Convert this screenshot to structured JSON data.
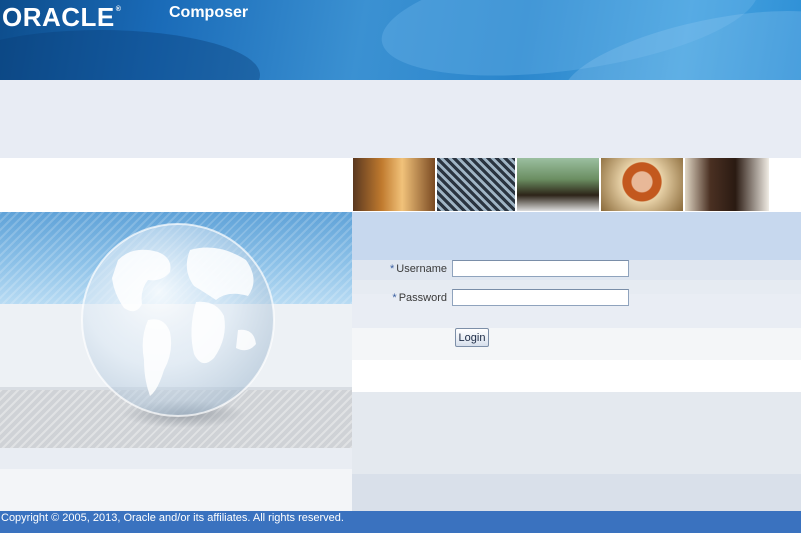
{
  "header": {
    "brand": "ORACLE",
    "brand_mark": "®",
    "app_title": "Composer"
  },
  "banner_photos": [
    {
      "name": "team-discussion-photo"
    },
    {
      "name": "transmission-tower-photo"
    },
    {
      "name": "computer-user-photo"
    },
    {
      "name": "headset-agent-photo"
    },
    {
      "name": "businessman-photo"
    }
  ],
  "login": {
    "required_mark": "*",
    "username_label": "Username",
    "username_value": "",
    "password_label": "Password",
    "password_value": "",
    "login_button": "Login"
  },
  "footer": {
    "copyright": "Copyright © 2005, 2013, Oracle and/or its affiliates. All rights reserved."
  },
  "colors": {
    "header_blue": "#1a6bb8",
    "footer_blue": "#3a72bf",
    "panel_light": "#e8ecf4"
  }
}
